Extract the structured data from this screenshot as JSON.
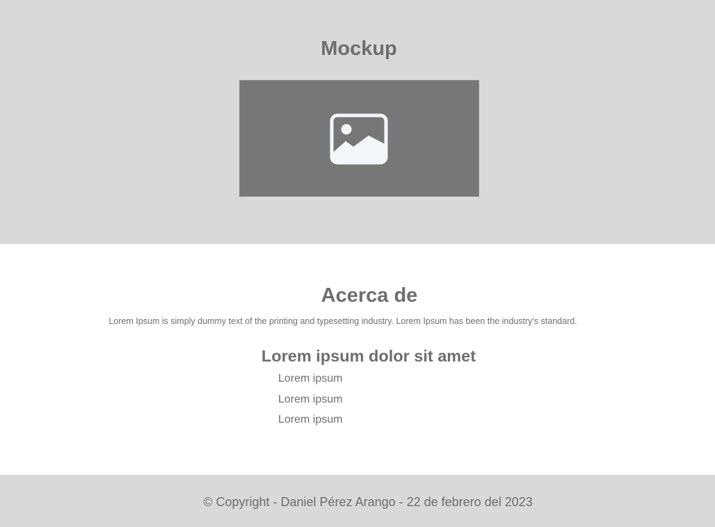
{
  "hero": {
    "title": "Mockup",
    "image_icon": "image-placeholder-icon",
    "background_color": "#d9d9d9",
    "image_color": "#777777"
  },
  "about": {
    "title": "Acerca de",
    "text": "Lorem Ipsum is simply dummy text of the printing and typesetting industry. Lorem Ipsum has been the industry's standard."
  },
  "list": {
    "title": "Lorem ipsum dolor sit amet",
    "items": [
      "Lorem ipsum",
      "Lorem ipsum",
      "Lorem ipsum"
    ]
  },
  "footer": {
    "text": "© Copyright - Daniel Pérez Arango - 22 de febrero del 2023"
  }
}
